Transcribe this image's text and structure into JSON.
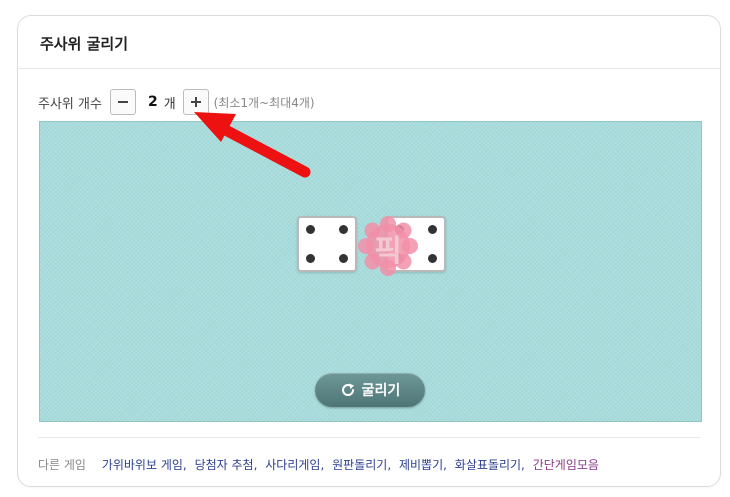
{
  "card": {
    "title": "주사위 굴리기"
  },
  "dice_count": {
    "label": "주사위 개수",
    "value": "2",
    "unit": "개",
    "hint": "(최소1개~최대4개)"
  },
  "dice": [
    {
      "face": 4
    },
    {
      "face": 4
    }
  ],
  "badge": {
    "text": "픽",
    "color": "#f28fa8"
  },
  "roll_button": {
    "label": "굴리기"
  },
  "footer": {
    "label": "다른 게임",
    "links": [
      "가위바위보 게임",
      "당첨자 추첨",
      "사다리게임",
      "원판돌리기",
      "제비뽑기",
      "화살표돌리기",
      "간단게임모음"
    ]
  },
  "colors": {
    "board": "#a8dcdc",
    "roll_button": "#5b8484",
    "link": "#2c3f8f",
    "link_special": "#8a3a8a",
    "annotation_arrow": "#ee1111"
  }
}
